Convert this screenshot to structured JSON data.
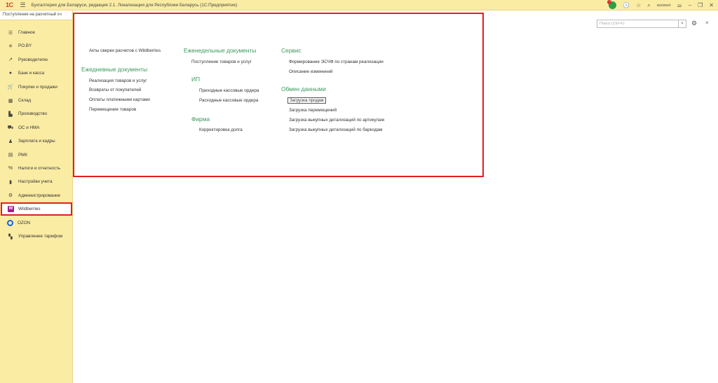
{
  "app": {
    "logo": "1С",
    "title": "Бухгалтерия для Беларуси, редакция 2.1. Локализация для Республики Беларусь  (1С:Предприятие)",
    "user": "assistant"
  },
  "sidebar": {
    "open_tab": "Поступление на расчетный сч",
    "items": [
      {
        "label": "Главное",
        "icon": "☰"
      },
      {
        "label": "PO.BY",
        "icon": "✳"
      },
      {
        "label": "Руководителю",
        "icon": "↗"
      },
      {
        "label": "Банк и касса",
        "icon": "●"
      },
      {
        "label": "Покупки и продажи",
        "icon": "🛒"
      },
      {
        "label": "Склад",
        "icon": "▦"
      },
      {
        "label": "Производство",
        "icon": "▙"
      },
      {
        "label": "ОС и НМА",
        "icon": "⛟"
      },
      {
        "label": "Зарплата и кадры",
        "icon": "♟"
      },
      {
        "label": "РМК",
        "icon": "▤"
      },
      {
        "label": "Налоги и отчетность",
        "icon": "%"
      },
      {
        "label": "Настройки учета",
        "icon": "▮"
      },
      {
        "label": "Администрирование",
        "icon": "⚙"
      },
      {
        "label": "Wildberries",
        "icon": "W"
      },
      {
        "label": "OZON",
        "icon": "◯"
      },
      {
        "label": "Управление тарифом",
        "icon": "▚"
      }
    ]
  },
  "search": {
    "placeholder": "Поиск (Ctrl+F)",
    "clear": "×"
  },
  "panel": {
    "col1": {
      "top_link": "Акты сверки расчетов с Wildberries",
      "group_daily": "Ежедневные документы",
      "daily": [
        "Реализация товаров и услуг",
        "Возвраты от покупателей",
        "Оплаты платежными картами",
        "Перемещение товаров"
      ]
    },
    "col2": {
      "group_weekly": "Еженедельные документы",
      "weekly": [
        "Поступление товаров и услуг"
      ],
      "group_ip": "ИП",
      "ip": [
        "Приходные кассовые ордера",
        "Расходные кассовые ордера"
      ],
      "group_firm": "Фирма",
      "firm": [
        "Корректировка долга"
      ]
    },
    "col3": {
      "group_service": "Сервис",
      "service": [
        "Формирование ЭСЧФ по странам реализации",
        "Описание изменений"
      ],
      "group_exchange": "Обмен данными",
      "exchange": [
        "Загрузка продаж",
        "Загрузка перемещений",
        "Загрузка выкупных детализаций по артикулам",
        "Загрузка выкупных детализаций по баркодам"
      ]
    }
  },
  "colors": {
    "accent_group": "#3a9a5a",
    "highlight": "#e02020",
    "sidebar_bg": "#fbeca4"
  }
}
